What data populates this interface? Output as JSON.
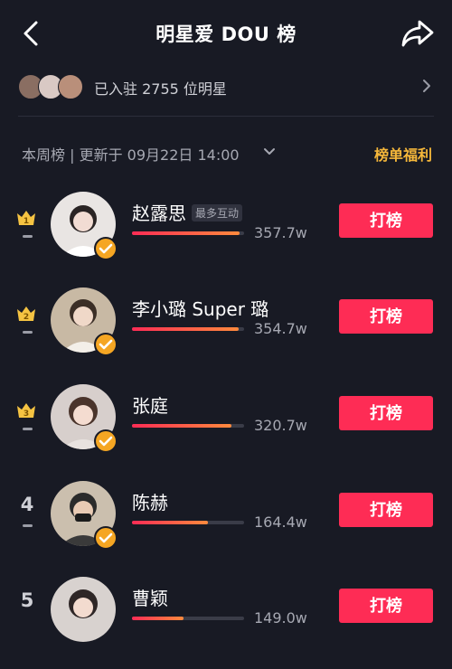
{
  "header": {
    "title": "明星爱 DOU 榜"
  },
  "summary": {
    "text": "已入驻 2755 位明星"
  },
  "subbar": {
    "period": "本周榜 | 更新于 09月22日 14:00",
    "welfare": "榜单福利"
  },
  "colors": {
    "accent": "#fe2c55",
    "gold": "#f5a623",
    "background": "#181a24"
  },
  "ranking": [
    {
      "rank": "1",
      "name": "赵露思",
      "tag": "最多互动",
      "score": "357.7w",
      "button": "打榜",
      "progress": 0.96
    },
    {
      "rank": "2",
      "name": "李小璐 Super 璐",
      "tag": "",
      "score": "354.7w",
      "button": "打榜",
      "progress": 0.95
    },
    {
      "rank": "3",
      "name": "张庭",
      "tag": "",
      "score": "320.7w",
      "button": "打榜",
      "progress": 0.89
    },
    {
      "rank": "4",
      "name": "陈赫",
      "tag": "",
      "score": "164.4w",
      "button": "打榜",
      "progress": 0.68
    },
    {
      "rank": "5",
      "name": "曹颖",
      "tag": "",
      "score": "149.0w",
      "button": "打榜",
      "progress": 0.46
    }
  ]
}
